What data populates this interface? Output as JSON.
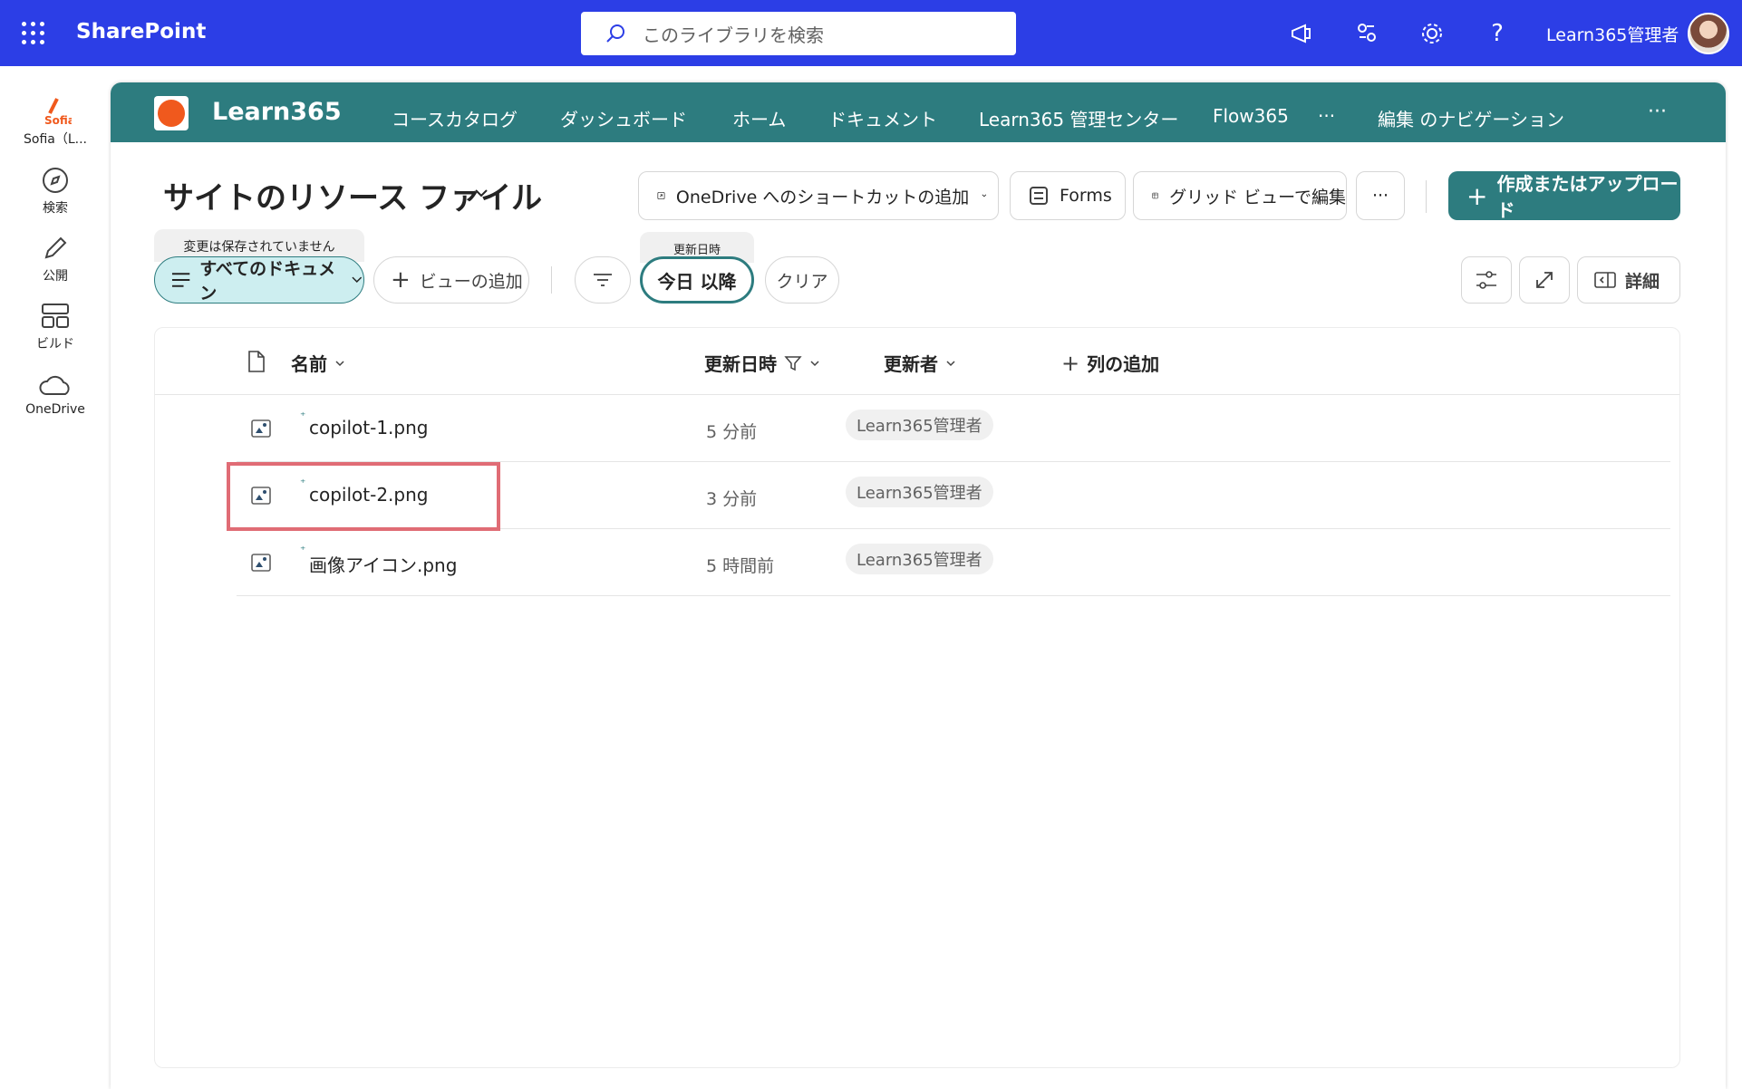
{
  "topbar": {
    "app_name": "SharePoint",
    "search_placeholder": "このライブラリを検索",
    "user_name": "Learn365管理者",
    "icons": [
      "waffle-icon",
      "megaphone-icon",
      "share-icon",
      "gear-icon",
      "help-icon"
    ],
    "help_label": "?"
  },
  "rail": {
    "items": [
      {
        "label": "Sofia（L...",
        "icon": "sofia-logo-icon",
        "logo_text": "Sofia"
      },
      {
        "label": "検索",
        "icon": "compass-icon"
      },
      {
        "label": "公開",
        "icon": "pen-icon"
      },
      {
        "label": "ビルド",
        "icon": "build-icon"
      },
      {
        "label": "OneDrive",
        "icon": "cloud-icon"
      }
    ]
  },
  "site": {
    "title": "Learn365",
    "nav": [
      "コースカタログ",
      "ダッシュボード",
      "ホーム",
      "ドキュメント",
      "Learn365 管理センター",
      "Flow365",
      "···",
      "編集 のナビゲーション"
    ],
    "more": "···",
    "header_color": "#2d7c7f"
  },
  "library": {
    "title": "サイトのリソース ファイル",
    "toolbar": {
      "shortcut_label": "OneDrive へのショートカットの追加",
      "forms_label": "Forms",
      "grid_label": "グリッド ビューで編集",
      "more_label": "···",
      "create_label": "作成またはアップロード",
      "create_plus": "+"
    },
    "views": {
      "unsaved_note": "変更は保存されていません",
      "current_view": "すべてのドキュメン",
      "add_view": "ビューの追加",
      "filter_header": "更新日時",
      "filter_value": "今日 以降",
      "clear": "クリア",
      "details": "詳細"
    },
    "columns": {
      "name": "名前",
      "modified": "更新日時",
      "modified_by": "更新者",
      "add_column": "列の追加"
    },
    "files": [
      {
        "name": "copilot-1.png",
        "modified": "5 分前",
        "modified_by": "Learn365管理者"
      },
      {
        "name": "copilot-2.png",
        "modified": "3 分前",
        "modified_by": "Learn365管理者"
      },
      {
        "name": "画像アイコン.png",
        "modified": "5 時間前",
        "modified_by": "Learn365管理者"
      }
    ]
  },
  "colors": {
    "suite_bar": "#2c3ee6",
    "accent": "#2d7c7f",
    "highlight": "#e06c75"
  }
}
